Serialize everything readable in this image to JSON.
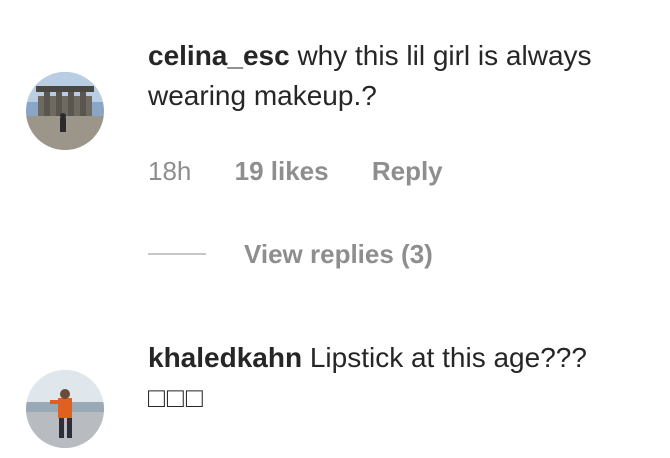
{
  "comments": [
    {
      "username": "celina_esc",
      "text": "why this lil girl is always wearing makeup.?",
      "time": "18h",
      "likes": "19 likes",
      "reply_label": "Reply",
      "view_replies": "View replies (3)"
    },
    {
      "username": "khaledkahn",
      "text": "Lipstick at this age???",
      "extra_text": "□□□"
    }
  ],
  "colors": {
    "primary_text": "#262626",
    "secondary_text": "#8e8e8e",
    "divider": "#c7c7c7"
  }
}
